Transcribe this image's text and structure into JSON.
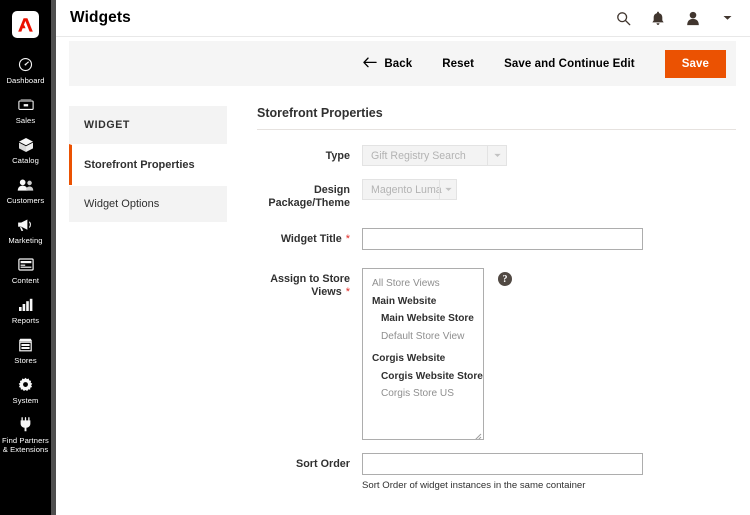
{
  "brand": {
    "logo_icon": "adobe-logo-icon",
    "logo_color": "#eb1000"
  },
  "sidebar": {
    "items": [
      {
        "label": "Dashboard",
        "icon": "dashboard-icon"
      },
      {
        "label": "Sales",
        "icon": "sales-icon"
      },
      {
        "label": "Catalog",
        "icon": "catalog-icon"
      },
      {
        "label": "Customers",
        "icon": "customers-icon"
      },
      {
        "label": "Marketing",
        "icon": "marketing-icon"
      },
      {
        "label": "Content",
        "icon": "content-icon"
      },
      {
        "label": "Reports",
        "icon": "reports-icon"
      },
      {
        "label": "Stores",
        "icon": "stores-icon"
      },
      {
        "label": "System",
        "icon": "system-icon"
      },
      {
        "label": "Find Partners\n& Extensions",
        "icon": "partners-icon"
      }
    ]
  },
  "header": {
    "title": "Widgets",
    "icons": [
      {
        "name": "search-icon"
      },
      {
        "name": "notifications-bell-icon"
      },
      {
        "name": "account-user-icon"
      },
      {
        "name": "chevron-down-icon"
      }
    ]
  },
  "page_actions": {
    "back_label": "Back",
    "back_icon": "arrow-left-icon",
    "reset_label": "Reset",
    "save_continue_label": "Save and Continue Edit",
    "save_label": "Save",
    "save_color": "#eb5202"
  },
  "tabs": {
    "heading": "WIDGET",
    "items": [
      {
        "label": "Storefront Properties",
        "active": true
      },
      {
        "label": "Widget Options",
        "active": false
      }
    ]
  },
  "form": {
    "section_title": "Storefront Properties",
    "type": {
      "label": "Type",
      "value": "Gift Registry Search",
      "disabled": true
    },
    "theme": {
      "label": "Design Package/Theme",
      "value": "Magento Luma",
      "disabled": true
    },
    "widget_title": {
      "label": "Widget Title",
      "required": "*",
      "value": "",
      "placeholder": ""
    },
    "store_views": {
      "label": "Assign to Store Views",
      "required": "*",
      "help_icon": "help-question-icon",
      "options": [
        {
          "text": "All Store Views",
          "level": 0
        },
        {
          "text": "Main Website",
          "level": 1
        },
        {
          "text": "Main Website Store",
          "level": 2
        },
        {
          "text": "Default Store View",
          "level": 3
        },
        {
          "text": "Corgis Website",
          "level": 1
        },
        {
          "text": "Corgis Website Store",
          "level": 2
        },
        {
          "text": "Corgis Store US",
          "level": 3
        }
      ]
    },
    "sort_order": {
      "label": "Sort Order",
      "value": "",
      "hint": "Sort Order of widget instances in the same container"
    }
  }
}
